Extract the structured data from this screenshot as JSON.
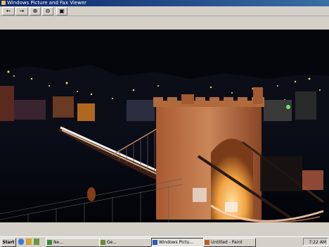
{
  "window": {
    "title": "Windows Picture and Fax Viewer"
  },
  "toolbar": {
    "buttons": [
      {
        "name": "previous-image-button",
        "glyph": "←"
      },
      {
        "name": "next-image-button",
        "glyph": "→"
      },
      {
        "name": "zoom-in-button",
        "glyph": "⊕"
      },
      {
        "name": "zoom-out-button",
        "glyph": "⊖"
      },
      {
        "name": "fit-button",
        "glyph": "▣"
      }
    ]
  },
  "photo": {
    "scene": "night-bridge-long-exposure",
    "colors": {
      "sky": "#05060c",
      "tower": "#c07a4a",
      "light_trail": "#ffe9b8",
      "archway": "#ffb85a"
    }
  },
  "taskbar": {
    "start_label": "Start",
    "quick_launch": [
      "browser-icon",
      "mail-icon",
      "media-icon"
    ],
    "tasks": [
      {
        "label": "Ne...",
        "active": false,
        "icon": "#3c8c3c"
      },
      {
        "label": "Ge...",
        "active": false,
        "icon": "#6f8a3a"
      },
      {
        "label": "Windows Pictu...",
        "active": true,
        "icon": "#2a5db0"
      },
      {
        "label": "Untitled - Paint",
        "active": false,
        "icon": "#c05a2a"
      }
    ],
    "clock": "7:22 AM"
  }
}
